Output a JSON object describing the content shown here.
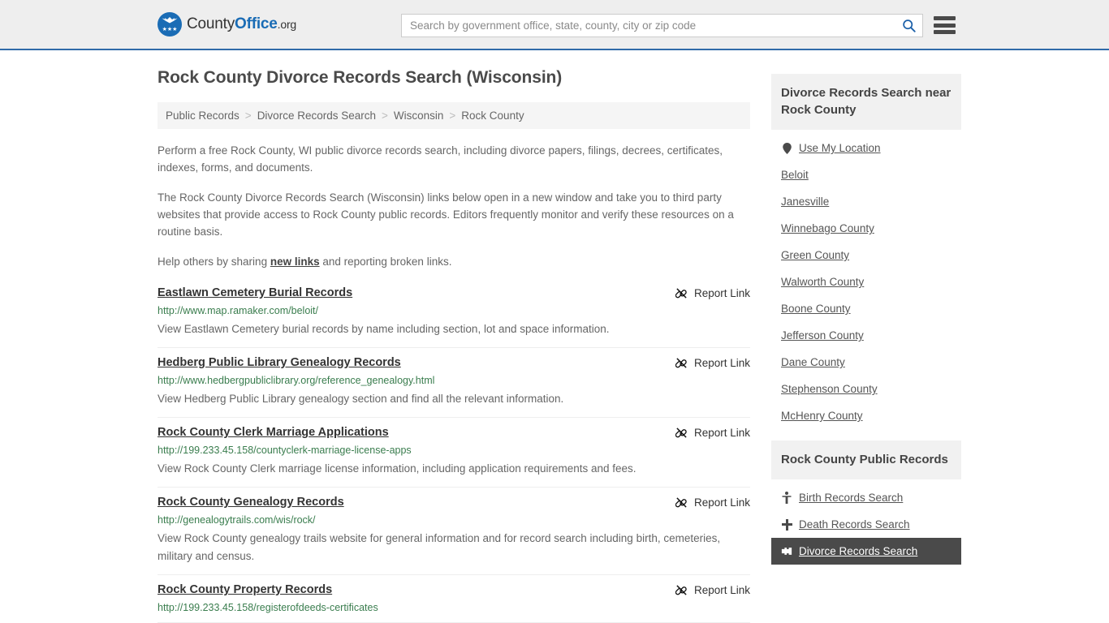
{
  "header": {
    "logo": {
      "part1": "County",
      "part2": "Office",
      "part3": ".org",
      "icon": "eagle-seal-icon"
    },
    "search": {
      "placeholder": "Search by government office, state, county, city or zip code",
      "value": "",
      "icon": "search-icon"
    },
    "menu_icon": "hamburger-menu-icon"
  },
  "page_title": "Rock County Divorce Records Search (Wisconsin)",
  "breadcrumb": {
    "separator": ">",
    "items": [
      "Public Records",
      "Divorce Records Search",
      "Wisconsin",
      "Rock County"
    ]
  },
  "intro": {
    "p1": "Perform a free Rock County, WI public divorce records search, including divorce papers, filings, decrees, certificates, indexes, forms, and documents.",
    "p2": "The Rock County Divorce Records Search (Wisconsin) links below open in a new window and take you to third party websites that provide access to Rock County public records. Editors frequently monitor and verify these resources on a routine basis.",
    "p3_before": "Help others by sharing ",
    "p3_link": "new links",
    "p3_after": " and reporting broken links."
  },
  "report_link_label": "Report Link",
  "report_link_icon": "broken-link-icon",
  "results": [
    {
      "title": "Eastlawn Cemetery Burial Records",
      "url": "http://www.map.ramaker.com/beloit/",
      "description": "View Eastlawn Cemetery burial records by name including section, lot and space information."
    },
    {
      "title": "Hedberg Public Library Genealogy Records",
      "url": "http://www.hedbergpubliclibrary.org/reference_genealogy.html",
      "description": "View Hedberg Public Library genealogy section and find all the relevant information."
    },
    {
      "title": "Rock County Clerk Marriage Applications",
      "url": "http://199.233.45.158/countyclerk-marriage-license-apps",
      "description": "View Rock County Clerk marriage license information, including application requirements and fees."
    },
    {
      "title": "Rock County Genealogy Records",
      "url": "http://genealogytrails.com/wis/rock/",
      "description": "View Rock County genealogy trails website for general information and for record search including birth, cemeteries, military and census."
    },
    {
      "title": "Rock County Property Records",
      "url": "http://199.233.45.158/registerofdeeds-certificates",
      "description": ""
    }
  ],
  "sidebar": {
    "nearby": {
      "heading": "Divorce Records Search near Rock County",
      "items": [
        {
          "label": "Use My Location",
          "icon": "map-pin-icon",
          "active": false
        },
        {
          "label": "Beloit",
          "icon": "",
          "active": false
        },
        {
          "label": "Janesville",
          "icon": "",
          "active": false
        },
        {
          "label": "Winnebago County",
          "icon": "",
          "active": false
        },
        {
          "label": "Green County",
          "icon": "",
          "active": false
        },
        {
          "label": "Walworth County",
          "icon": "",
          "active": false
        },
        {
          "label": "Boone County",
          "icon": "",
          "active": false
        },
        {
          "label": "Jefferson County",
          "icon": "",
          "active": false
        },
        {
          "label": "Dane County",
          "icon": "",
          "active": false
        },
        {
          "label": "Stephenson County",
          "icon": "",
          "active": false
        },
        {
          "label": "McHenry County",
          "icon": "",
          "active": false
        }
      ]
    },
    "public_records": {
      "heading": "Rock County Public Records",
      "items": [
        {
          "label": "Birth Records Search",
          "icon": "baby-icon",
          "active": false
        },
        {
          "label": "Death Records Search",
          "icon": "cross-icon",
          "active": false
        },
        {
          "label": "Divorce Records Search",
          "icon": "broken-heart-icon",
          "active": true
        }
      ]
    }
  },
  "colors": {
    "brand_blue": "#1a6cb5",
    "header_bg": "#eeeeee",
    "header_border": "#2f6aa8",
    "url_green": "#3a7d4e",
    "active_dark": "#4a4a4a"
  }
}
